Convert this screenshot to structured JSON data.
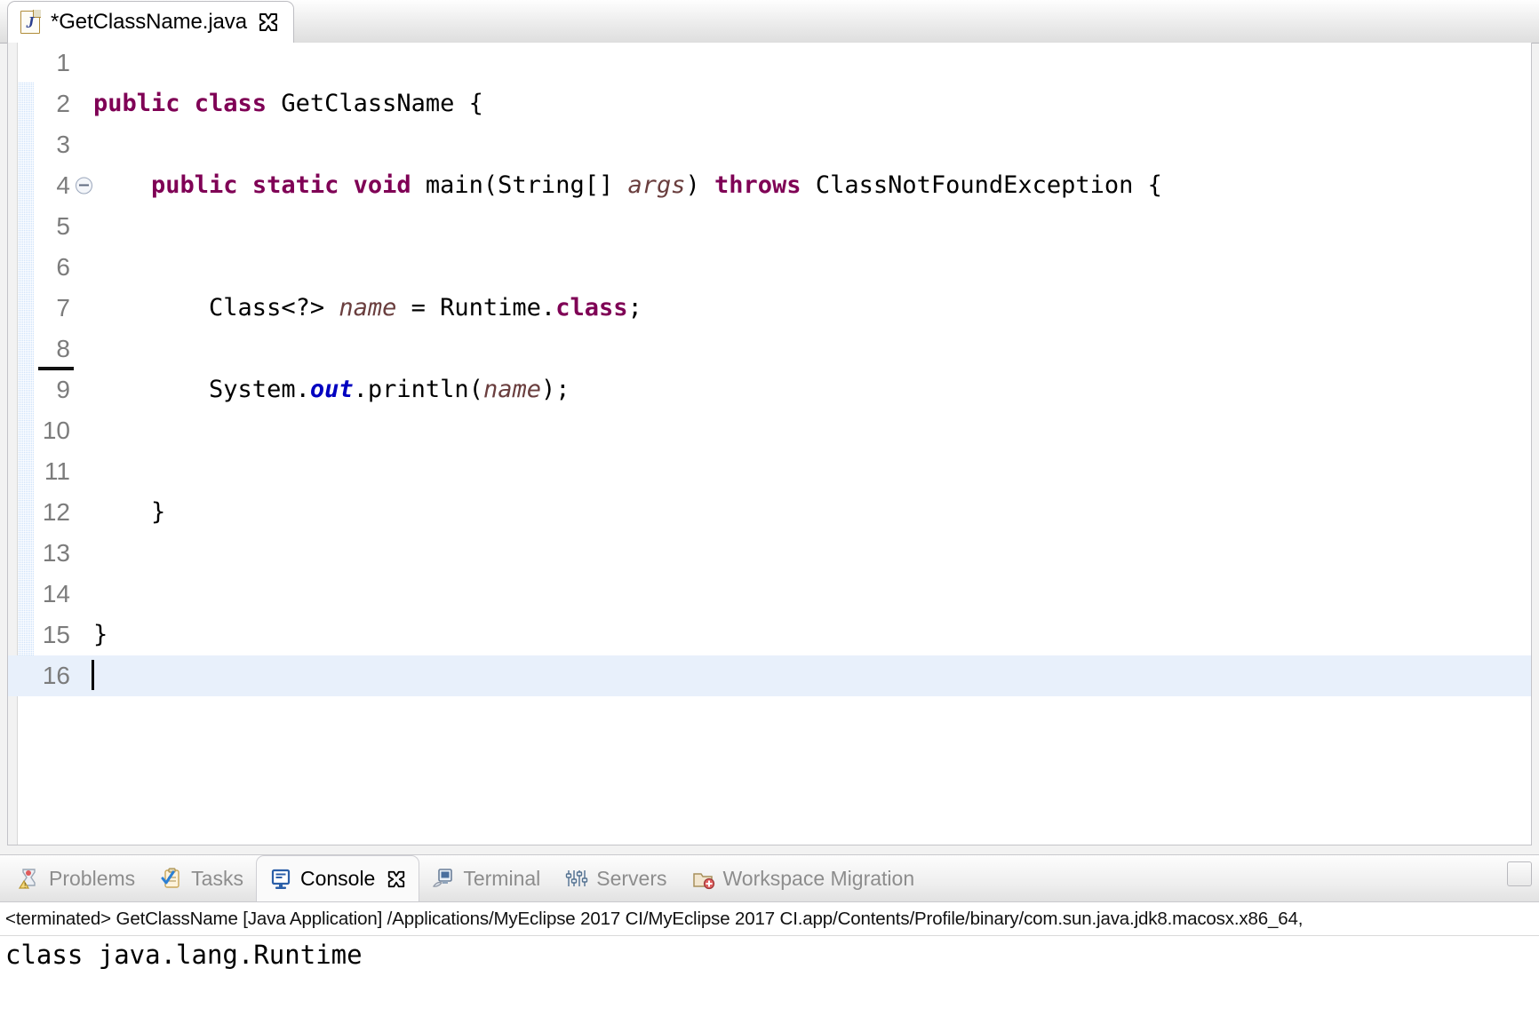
{
  "window": {
    "app": "MyEclipse 2017 CI"
  },
  "editor": {
    "tab": {
      "title": "*GetClassName.java",
      "icon": "java-file-icon",
      "letter": "J",
      "close_icon": "close-icon"
    },
    "lines": [
      {
        "n": "1",
        "fold": false,
        "segments": []
      },
      {
        "n": "2",
        "fold": false,
        "segments": [
          {
            "t": "public class ",
            "c": "kw"
          },
          {
            "t": "GetClassName {",
            "c": "plain"
          }
        ]
      },
      {
        "n": "3",
        "fold": false,
        "segments": []
      },
      {
        "n": "4",
        "fold": true,
        "segments": [
          {
            "t": "    ",
            "c": "plain"
          },
          {
            "t": "public static void ",
            "c": "kw"
          },
          {
            "t": "main(String[] ",
            "c": "plain"
          },
          {
            "t": "args",
            "c": "loc"
          },
          {
            "t": ") ",
            "c": "plain"
          },
          {
            "t": "throws ",
            "c": "kw"
          },
          {
            "t": "ClassNotFoundException {",
            "c": "plain"
          }
        ]
      },
      {
        "n": "5",
        "fold": false,
        "segments": []
      },
      {
        "n": "6",
        "fold": false,
        "segments": []
      },
      {
        "n": "7",
        "fold": false,
        "segments": [
          {
            "t": "        Class<?> ",
            "c": "plain"
          },
          {
            "t": "name",
            "c": "loc"
          },
          {
            "t": " = Runtime.",
            "c": "plain"
          },
          {
            "t": "class",
            "c": "kw"
          },
          {
            "t": ";",
            "c": "plain"
          }
        ]
      },
      {
        "n": "8",
        "fold": false,
        "segments": []
      },
      {
        "n": "9",
        "fold": false,
        "segments": [
          {
            "t": "        System.",
            "c": "plain"
          },
          {
            "t": "out",
            "c": "sfld"
          },
          {
            "t": ".println(",
            "c": "plain"
          },
          {
            "t": "name",
            "c": "loc"
          },
          {
            "t": ");",
            "c": "plain"
          }
        ]
      },
      {
        "n": "10",
        "fold": false,
        "segments": []
      },
      {
        "n": "11",
        "fold": false,
        "segments": []
      },
      {
        "n": "12",
        "fold": false,
        "segments": [
          {
            "t": "    }",
            "c": "plain"
          }
        ]
      },
      {
        "n": "13",
        "fold": false,
        "segments": []
      },
      {
        "n": "14",
        "fold": false,
        "segments": []
      },
      {
        "n": "15",
        "fold": false,
        "segments": [
          {
            "t": "}",
            "c": "plain"
          }
        ]
      },
      {
        "n": "16",
        "fold": false,
        "current": true,
        "caret": true,
        "segments": []
      }
    ]
  },
  "bottom": {
    "tabs": [
      {
        "label": "Problems",
        "icon": "problems-icon",
        "active": false,
        "closable": false
      },
      {
        "label": "Tasks",
        "icon": "tasks-icon",
        "active": false,
        "closable": false
      },
      {
        "label": "Console",
        "icon": "console-icon",
        "active": true,
        "closable": true
      },
      {
        "label": "Terminal",
        "icon": "terminal-icon",
        "active": false,
        "closable": false
      },
      {
        "label": "Servers",
        "icon": "servers-icon",
        "active": false,
        "closable": false
      },
      {
        "label": "Workspace Migration",
        "icon": "migration-icon",
        "active": false,
        "closable": false
      }
    ],
    "minimize_icon": "minimize-button",
    "console": {
      "header": "<terminated> GetClassName [Java Application] /Applications/MyEclipse 2017 CI/MyEclipse 2017 CI.app/Contents/Profile/binary/com.sun.java.jdk8.macosx.x86_64,",
      "output": "class java.lang.Runtime"
    }
  },
  "colors": {
    "keyword": "#7f0055",
    "local_var": "#6a3e3e",
    "static_field": "#0000c0",
    "current_line": "#e8f0fb",
    "change_bar": "#cfe2fa"
  }
}
